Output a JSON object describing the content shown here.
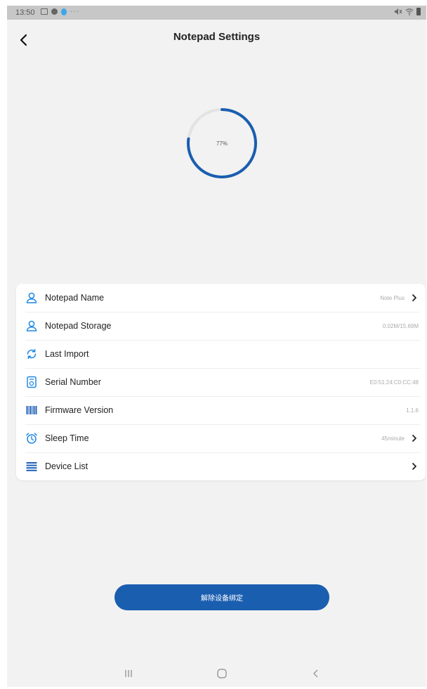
{
  "status_bar": {
    "time": "13:50",
    "more": "···"
  },
  "header": {
    "title": "Notepad Settings",
    "back_icon": "chevron-left-icon"
  },
  "progress": {
    "value": 77,
    "label": "77%",
    "color": "#1a5eb0",
    "track_color": "#e3e3e3"
  },
  "settings": {
    "items": [
      {
        "label": "Notepad Name",
        "value": "Note Plus",
        "icon": "person-icon",
        "chevron": true
      },
      {
        "label": "Notepad Storage",
        "value": "0.02M/15.69M",
        "icon": "person-icon",
        "chevron": false
      },
      {
        "label": "Last Import",
        "value": "",
        "icon": "sync-icon",
        "chevron": false
      },
      {
        "label": "Serial Number",
        "value": "E0:51:24:C0:CC:48",
        "icon": "device-icon",
        "chevron": false
      },
      {
        "label": "Firmware Version",
        "value": "1.1.6",
        "icon": "barcode-icon",
        "chevron": false
      },
      {
        "label": "Sleep Time",
        "value": "45minute",
        "icon": "alarm-clock-icon",
        "chevron": true
      },
      {
        "label": "Device List",
        "value": "",
        "icon": "list-icon",
        "chevron": true
      }
    ]
  },
  "unbind_button": {
    "label": "解除设备绑定"
  },
  "nav_bar": {
    "recent_icon": "recent-apps-icon",
    "home_icon": "home-icon",
    "back_icon": "nav-back-icon"
  },
  "colors": {
    "accent": "#1a5eb0",
    "background": "#f2f2f2",
    "icon_blue": "#1e88e5"
  }
}
